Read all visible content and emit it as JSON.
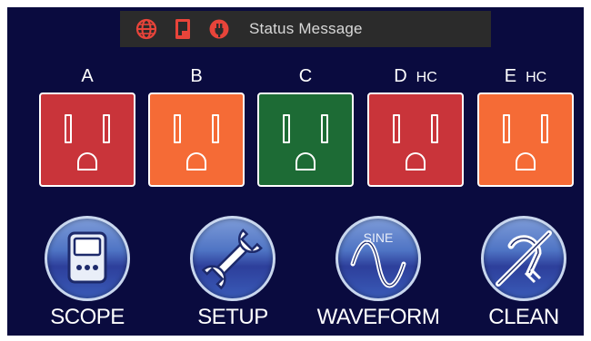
{
  "status_bar": {
    "icons": [
      "globe-icon",
      "document-icon",
      "power-plug-icon"
    ],
    "icon_color": "#e8443a",
    "message": "Status Message"
  },
  "outlets": [
    {
      "letter": "A",
      "suffix": "",
      "color": "#c9343a"
    },
    {
      "letter": "B",
      "suffix": "",
      "color": "#f56b36"
    },
    {
      "letter": "C",
      "suffix": "",
      "color": "#1d6b35"
    },
    {
      "letter": "D",
      "suffix": "HC",
      "color": "#c9343a"
    },
    {
      "letter": "E",
      "suffix": "HC",
      "color": "#f56b36"
    }
  ],
  "tools": [
    {
      "label": "SCOPE",
      "icon": "scope-icon"
    },
    {
      "label": "SETUP",
      "icon": "wrench-icon"
    },
    {
      "label": "WAVEFORM",
      "icon": "sine-wave-icon",
      "icon_text": "SINE"
    },
    {
      "label": "CLEAN",
      "icon": "clean-icon"
    }
  ],
  "colors": {
    "background": "#0a0b3f",
    "status_bar": "#2b2b2b"
  }
}
